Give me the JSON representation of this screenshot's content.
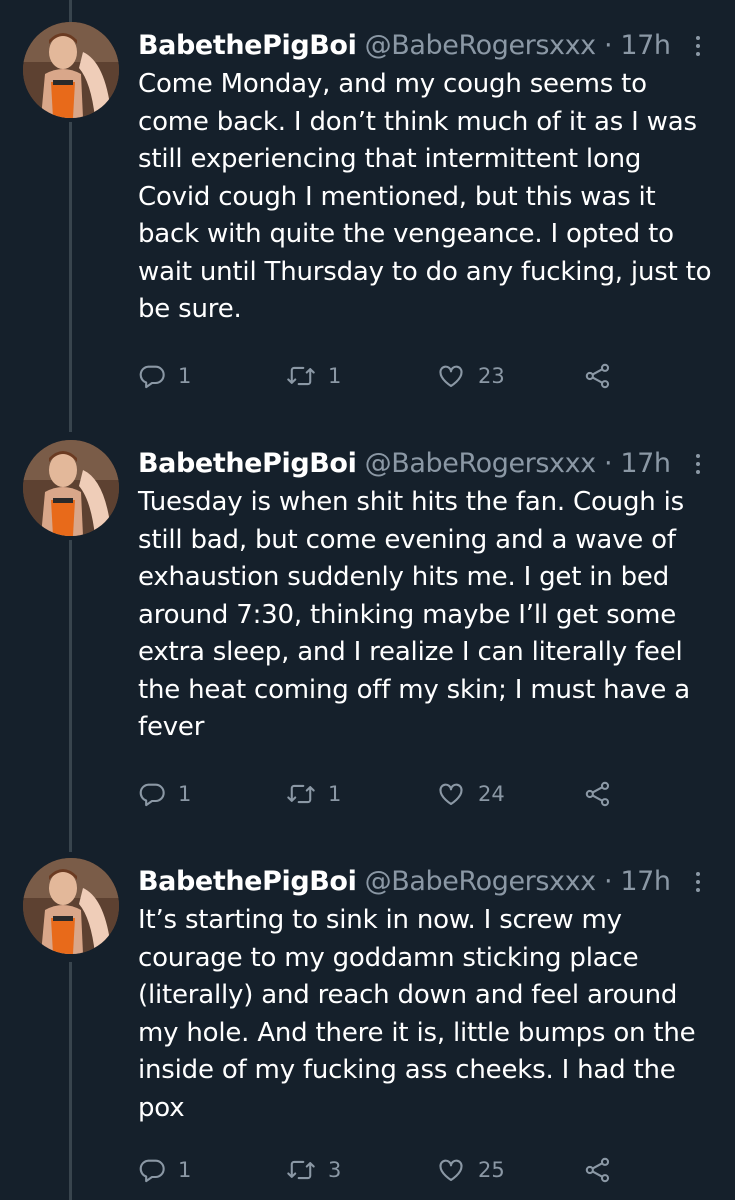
{
  "tweets": [
    {
      "name": "BabethePigBoi",
      "handle": "@BabeRogersxxx",
      "dot": "·",
      "time": "17h",
      "text": "Come Monday, and my cough seems to come back. I don’t think much of it as I was still experiencing that intermittent long Covid cough I mentioned, but this was it back with quite the vengeance. I opted to wait until Thursday to do any fucking, just to be sure.",
      "reply_count": "1",
      "retweet_count": "1",
      "like_count": "23"
    },
    {
      "name": "BabethePigBoi",
      "handle": "@BabeRogersxxx",
      "dot": "·",
      "time": "17h",
      "text": "Tuesday is when shit hits the fan. Cough is still bad, but come evening and a wave of exhaustion suddenly hits me. I get in bed around 7:30, thinking maybe I’ll get some extra sleep, and I realize I can literally feel the heat coming off my skin; I must have a fever",
      "reply_count": "1",
      "retweet_count": "1",
      "like_count": "24"
    },
    {
      "name": "BabethePigBoi",
      "handle": "@BabeRogersxxx",
      "dot": "·",
      "time": "17h",
      "text": "It’s starting to sink in now. I screw my courage to my goddamn sticking place (literally) and reach down and feel around my hole. And there it is, little bumps on the inside of my fucking ass cheeks. I had the pox",
      "reply_count": "1",
      "retweet_count": "3",
      "like_count": "25"
    }
  ],
  "icons": {
    "reply": "reply-icon",
    "retweet": "retweet-icon",
    "like": "like-icon",
    "share": "share-icon",
    "more": "more-options-icon"
  },
  "colors": {
    "background": "#15202b",
    "secondary_text": "#8b98a5",
    "thread_line": "#38444d"
  }
}
